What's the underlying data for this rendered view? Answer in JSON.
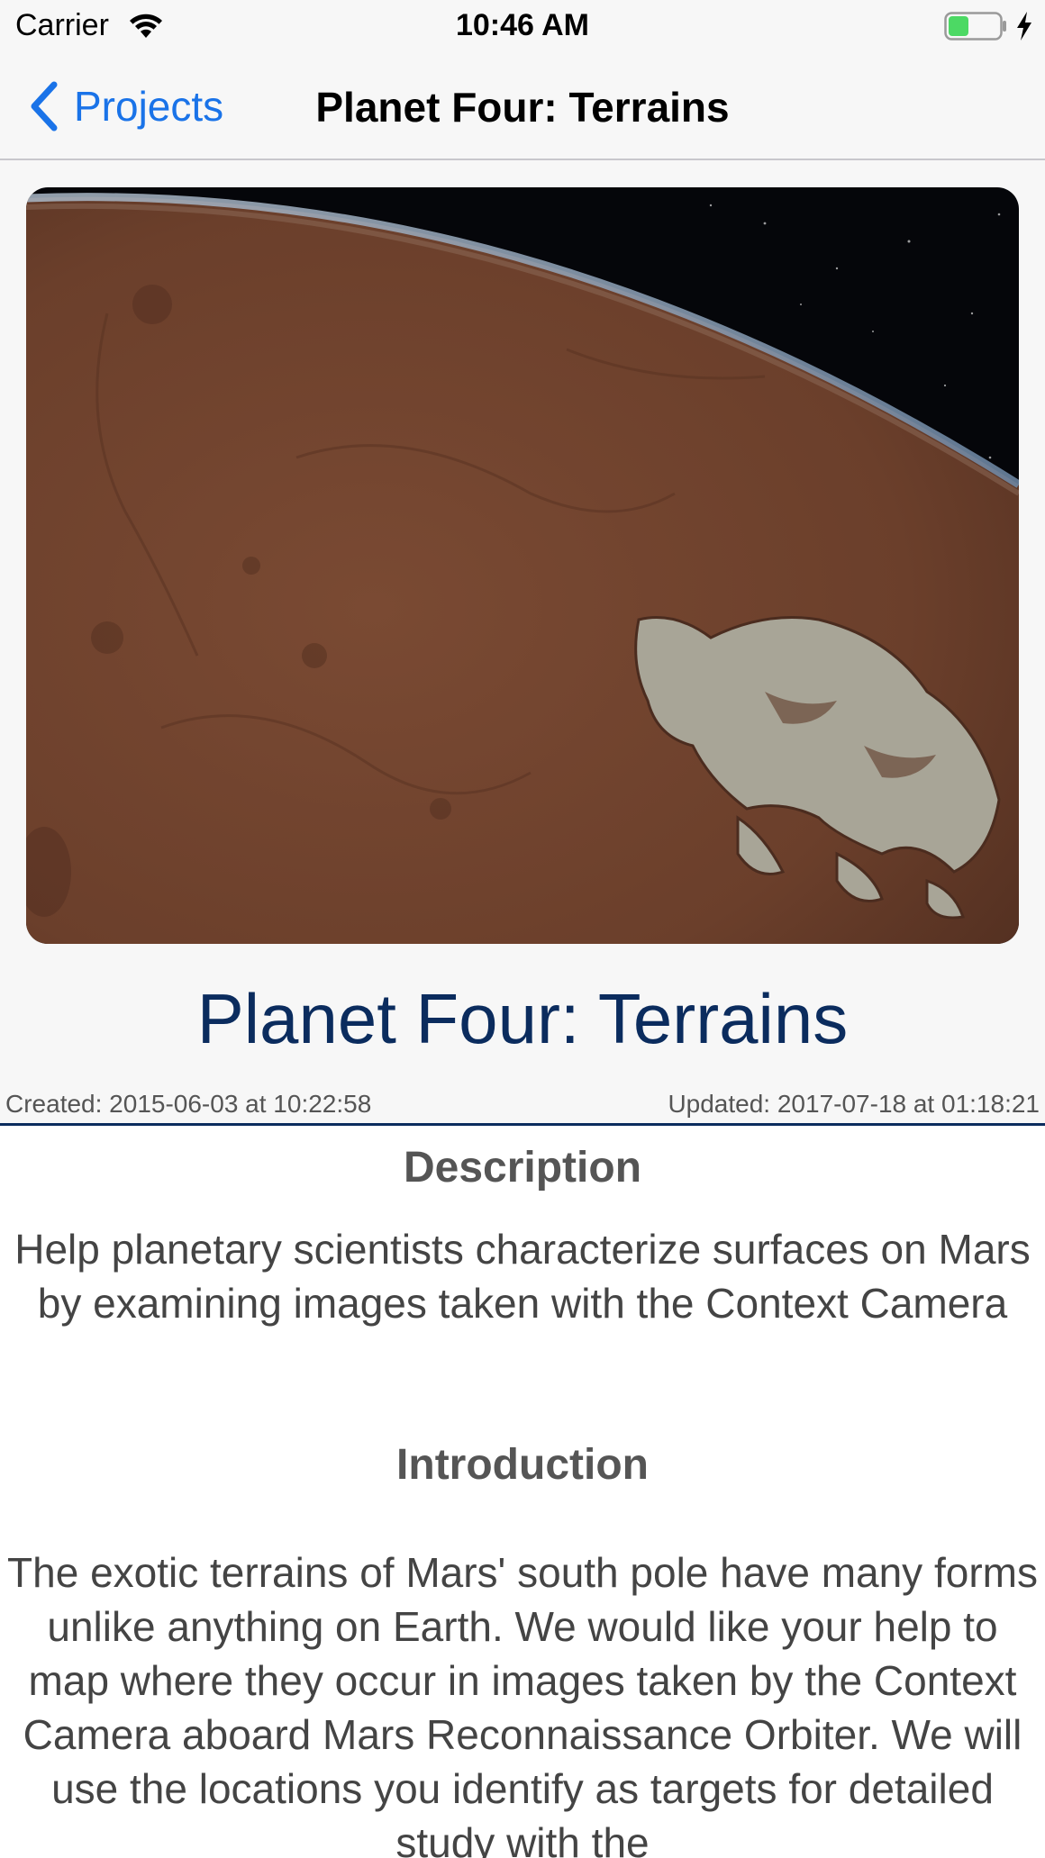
{
  "status_bar": {
    "carrier": "Carrier",
    "time": "10:46 AM",
    "icons": [
      "wifi-icon",
      "battery-icon",
      "charging-bolt-icon"
    ],
    "battery_color": "#4cd964"
  },
  "nav": {
    "back_label": "Projects",
    "title": "Planet Four: Terrains",
    "back_icon": "chevron-left-icon",
    "accent_color": "#1a73e8"
  },
  "project": {
    "title": "Planet Four: Terrains",
    "created": "Created: 2015-06-03 at 10:22:58",
    "updated": "Updated: 2017-07-18 at 01:18:21",
    "title_color": "#0b2c5e"
  },
  "description": {
    "heading": "Description",
    "body": "Help planetary scientists characterize surfaces on Mars by examining images taken with the Context Camera"
  },
  "introduction": {
    "heading": "Introduction",
    "body": "The exotic terrains of Mars' south pole have many forms unlike anything on Earth.  We would like your help to map where they occur in images taken by the Context Camera aboard Mars Reconnaissance Orbiter. We will use the locations you identify as targets for detailed study with the"
  }
}
